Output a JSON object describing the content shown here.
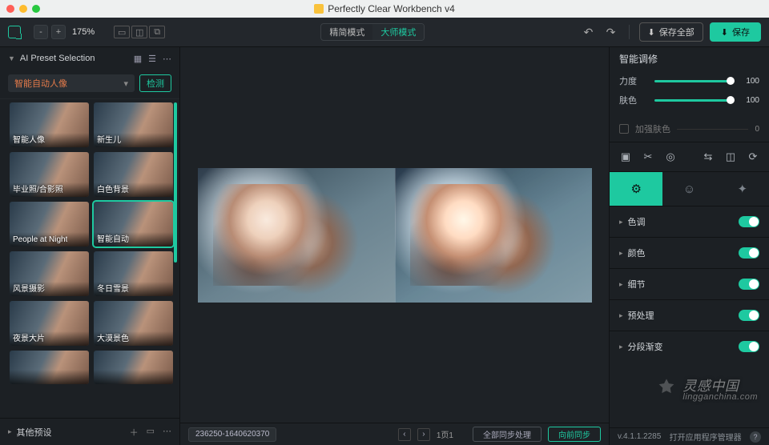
{
  "app": {
    "title": "Perfectly Clear Workbench v4"
  },
  "toolbar": {
    "zoom_minus": "-",
    "zoom_plus": "+",
    "zoom_value": "175%",
    "mode_simple": "精简模式",
    "mode_master": "大师模式",
    "save_all": "保存全部",
    "save": "保存"
  },
  "left": {
    "header": "AI Preset Selection",
    "preset_selected": "智能自动人像",
    "detect": "检测",
    "tiles": [
      {
        "label": "智能人像",
        "sel": false
      },
      {
        "label": "新生儿",
        "sel": false
      },
      {
        "label": "毕业照/合影照",
        "sel": false
      },
      {
        "label": "白色背景",
        "sel": false
      },
      {
        "label": "People at Night",
        "sel": false
      },
      {
        "label": "智能自动",
        "sel": true
      },
      {
        "label": "风景摄影",
        "sel": false
      },
      {
        "label": "冬日雪景",
        "sel": false
      },
      {
        "label": "夜景大片",
        "sel": false
      },
      {
        "label": "大漠景色",
        "sel": false
      },
      {
        "label": "",
        "sel": false
      },
      {
        "label": "",
        "sel": false
      }
    ],
    "footer": "其他预设"
  },
  "center": {
    "filename": "236250-1640620370",
    "page": "1页1",
    "process_all": "全部同步处理",
    "sync": "向前同步"
  },
  "right": {
    "title": "智能调修",
    "sliders": [
      {
        "label": "力度",
        "value": "100"
      },
      {
        "label": "肤色",
        "value": "100"
      }
    ],
    "enhance_skin": "加强肤色",
    "enhance_val": "0",
    "tabs_active": 0,
    "acc": [
      {
        "label": "色调",
        "on": true
      },
      {
        "label": "颜色",
        "on": true
      },
      {
        "label": "细节",
        "on": true
      },
      {
        "label": "预处理",
        "on": true
      },
      {
        "label": "分段渐变",
        "on": true
      }
    ],
    "version": "v.4.1.1.2285",
    "open_mgr": "打开应用程序管理器"
  },
  "watermark": {
    "main": "灵感中国",
    "sub": "lingganchina.com"
  }
}
